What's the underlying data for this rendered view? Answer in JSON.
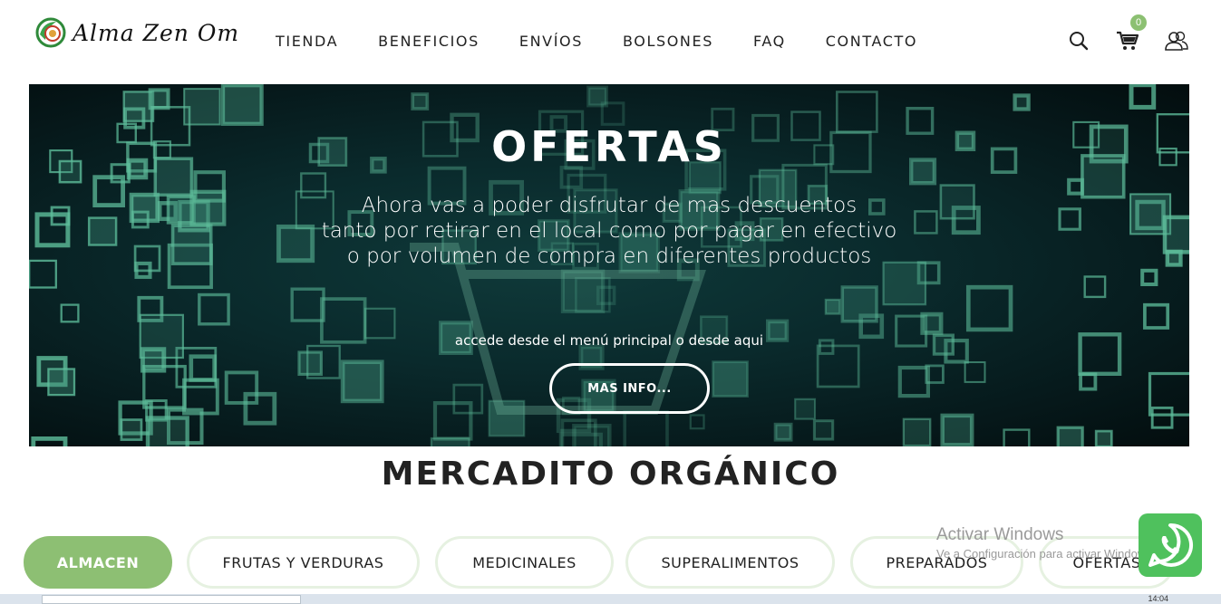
{
  "brand": {
    "name": "Alma Zen Om",
    "logo_icon": "alma-zen-om-logo"
  },
  "nav": [
    "TIENDA",
    "BENEFICIOS",
    "ENVÍOS",
    "BOLSONES",
    "FAQ",
    "CONTACTO"
  ],
  "header_icons": {
    "search": "search-icon",
    "cart": "cart-icon",
    "account": "user-icon",
    "cart_count": "0"
  },
  "hero": {
    "title": "OFERTAS",
    "lines": [
      "Ahora vas a poder disfrutar de mas descuentos",
      "tanto por retirar en el local como por pagar en efectivo",
      "o por volumen de compra en diferentes productos"
    ],
    "subtitle": "accede desde el menú principal o desde aqui",
    "button": "MAS INFO..."
  },
  "section_title": "MERCADITO ORGÁNICO",
  "categories": [
    "ALMACEN",
    "FRUTAS Y VERDURAS",
    "MEDICINALES",
    "SUPERALIMENTOS",
    "PREPARADOS",
    "OFERTAS"
  ],
  "active_category": "ALMACEN",
  "watermark": {
    "line1": "Activar Windows",
    "line2": "Ve a Configuración para activar Windows."
  },
  "taskbar": {
    "clock": "14:04"
  },
  "colors": {
    "accent_green": "#8dbf73",
    "whatsapp_green": "#4fc15d",
    "hero_dark": "#0a2a2c"
  }
}
